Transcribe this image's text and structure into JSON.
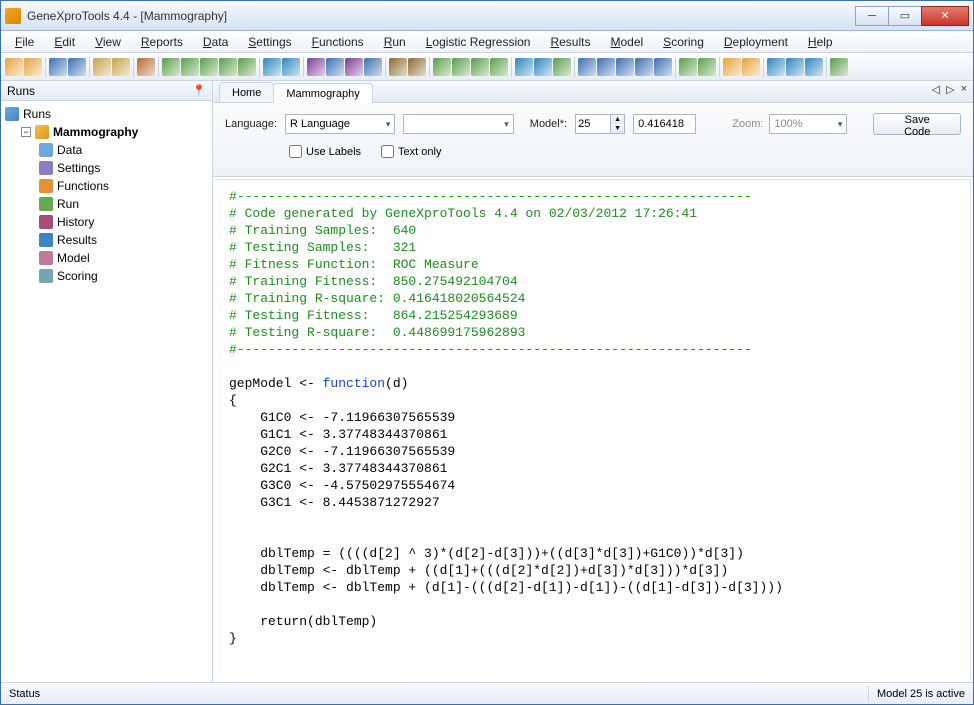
{
  "window": {
    "title": "GeneXproTools 4.4 - [Mammography]"
  },
  "menu": [
    "File",
    "Edit",
    "View",
    "Reports",
    "Data",
    "Settings",
    "Functions",
    "Run",
    "Logistic Regression",
    "Results",
    "Model",
    "Scoring",
    "Deployment",
    "Help"
  ],
  "sidebar": {
    "title": "Runs",
    "root": "Runs",
    "project": "Mammography",
    "items": [
      "Data",
      "Settings",
      "Functions",
      "Run",
      "History",
      "Results",
      "Model",
      "Scoring"
    ]
  },
  "tabs": {
    "items": [
      "Home",
      "Mammography"
    ],
    "active": 1
  },
  "params": {
    "language_label": "Language:",
    "language_value": "R Language",
    "secondary_value": "",
    "model_label": "Model*:",
    "model_value": "25",
    "model_score": "0.416418",
    "zoom_label": "Zoom:",
    "zoom_value": "100%",
    "save_label": "Save Code",
    "use_labels": "Use Labels",
    "text_only": "Text only"
  },
  "code": {
    "hr": "#------------------------------------------------------------------",
    "c1": "# Code generated by GeneXproTools 4.4 on 02/03/2012 17:26:41",
    "c2": "# Training Samples:  640",
    "c3": "# Testing Samples:   321",
    "c4": "# Fitness Function:  ROC Measure",
    "c5": "# Training Fitness:  850.275492104704",
    "c6": "# Training R-square: 0.416418020564524",
    "c7": "# Testing Fitness:   864.215254293689",
    "c8": "# Testing R-square:  0.448699175962893",
    "fn_pre": "gepModel <- ",
    "fn_kw": "function",
    "fn_post": "(d)",
    "body": "{\n    G1C0 <- -7.11966307565539\n    G1C1 <- 3.37748344370861\n    G2C0 <- -7.11966307565539\n    G2C1 <- 3.37748344370861\n    G3C0 <- -4.57502975554674\n    G3C1 <- 8.4453871272927\n\n\n    dblTemp = ((((d[2] ^ 3)*(d[2]-d[3]))+((d[3]*d[3])+G1C0))*d[3])\n    dblTemp <- dblTemp + ((d[1]+(((d[2]*d[2])+d[3])*d[3]))*d[3])\n    dblTemp <- dblTemp + (d[1]-(((d[2]-d[1])-d[1])-((d[1]-d[3])-d[3])))\n\n    return(dblTemp)\n}"
  },
  "status": {
    "left": "Status",
    "right": "Model 25 is active"
  },
  "toolbar_colors": [
    "#e8a23c",
    "#e8a23c",
    "#3b6fb5",
    "#3b6fb5",
    "#caa24a",
    "#caa24a",
    "#b46b2e",
    "#5a9e4a",
    "#5a9e4a",
    "#5a9e4a",
    "#5a9e4a",
    "#5a9e4a",
    "#2e86c1",
    "#2e86c1",
    "#7d3c98",
    "#3b6fb5",
    "#7d3c98",
    "#3b6fb5",
    "#8e6b2e",
    "#8e6b2e",
    "#5a9e4a",
    "#5a9e4a",
    "#5a9e4a",
    "#5a9e4a",
    "#2e86c1",
    "#2e86c1",
    "#5a9e4a",
    "#3b6fb5",
    "#3b6fb5",
    "#3b6fb5",
    "#3b6fb5",
    "#3b6fb5",
    "#5a9e4a",
    "#5a9e4a",
    "#e8a23c",
    "#e8a23c",
    "#2e86c1",
    "#2e86c1",
    "#2e86c1",
    "#5a9e4a"
  ]
}
